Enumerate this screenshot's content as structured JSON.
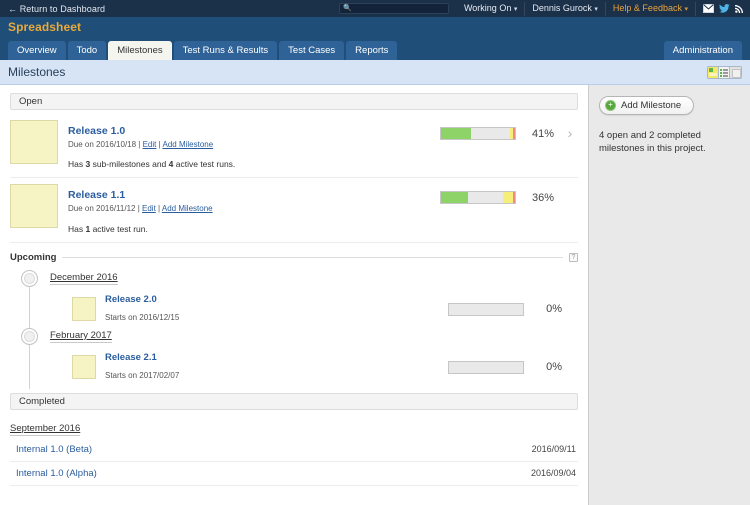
{
  "topbar": {
    "return_link": "← Return to Dashboard",
    "search_placeholder": "",
    "search_value": "",
    "working_on": "Working On",
    "user": "Dennis Gurock",
    "help": "Help & Feedback",
    "caret": "▾",
    "search_icon": "search-icon"
  },
  "project": {
    "title": "Spreadsheet"
  },
  "tabs": [
    {
      "label": "Overview",
      "active": false
    },
    {
      "label": "Todo",
      "active": false
    },
    {
      "label": "Milestones",
      "active": true
    },
    {
      "label": "Test Runs & Results",
      "active": false
    },
    {
      "label": "Test Cases",
      "active": false
    },
    {
      "label": "Reports",
      "active": false
    }
  ],
  "admin_label": "Administration",
  "page": {
    "title": "Milestones",
    "help_glyph": "?"
  },
  "sidebar": {
    "add_label": "Add Milestone",
    "plus_glyph": "+",
    "note": "4 open and 2 completed milestones in this project."
  },
  "sections": {
    "open": "Open",
    "upcoming": "Upcoming",
    "completed": "Completed"
  },
  "open_milestones": [
    {
      "name": "Release 1.0",
      "due": "Due on 2016/10/18",
      "sep1": " | ",
      "edit": "Edit",
      "sep2": " | ",
      "add": "Add Milestone",
      "summary_pre": "Has ",
      "summary_n1": "3",
      "summary_mid": " sub-milestones and ",
      "summary_n2": "4",
      "summary_post": " active test runs.",
      "percent": "41%",
      "has_chevron": true,
      "chevron": "›",
      "bar": {
        "green": 41,
        "gray": 52,
        "yellow": 5,
        "red": 2
      }
    },
    {
      "name": "Release 1.1",
      "due": "Due on 2016/11/12",
      "sep1": " | ",
      "edit": "Edit",
      "sep2": " | ",
      "add": "Add Milestone",
      "summary_pre": "Has ",
      "summary_n1": "1",
      "summary_mid": "",
      "summary_n2": "",
      "summary_post": " active test run.",
      "percent": "36%",
      "has_chevron": false,
      "chevron": "›",
      "bar": {
        "green": 36,
        "gray": 48,
        "yellow": 13,
        "red": 3
      }
    }
  ],
  "upcoming_groups": [
    {
      "month": "December 2016",
      "items": [
        {
          "name": "Release 2.0",
          "starts": "Starts on 2016/12/15",
          "percent": "0%",
          "bar": {
            "green": 0,
            "gray": 100,
            "yellow": 0,
            "red": 0
          }
        }
      ]
    },
    {
      "month": "February 2017",
      "items": [
        {
          "name": "Release 2.1",
          "starts": "Starts on 2017/02/07",
          "percent": "0%",
          "bar": {
            "green": 0,
            "gray": 100,
            "yellow": 0,
            "red": 0
          }
        }
      ]
    }
  ],
  "completed_groups": [
    {
      "month": "September 2016",
      "items": [
        {
          "name": "Internal 1.0 (Beta)",
          "date": "2016/09/11"
        },
        {
          "name": "Internal 1.0 (Alpha)",
          "date": "2016/09/04"
        }
      ]
    }
  ],
  "colors": {
    "chrome": "#1f4e79",
    "topbar": "#1b3049",
    "accent": "#e9a93b",
    "link": "#2a5d9e",
    "bar_green": "#8ed368",
    "bar_yellow": "#f5ef7a",
    "bar_red": "#f08a8a",
    "thumb": "#f6f3c4"
  }
}
